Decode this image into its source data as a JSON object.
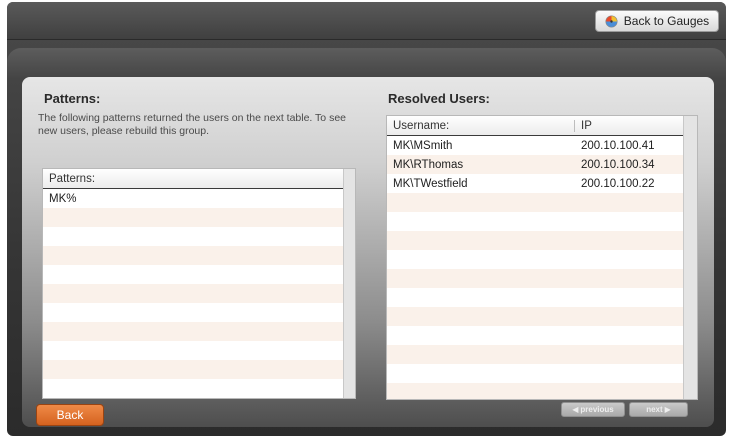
{
  "topbar": {
    "back_to_gauges_label": "Back to Gauges"
  },
  "patterns_section": {
    "title": "Patterns:",
    "description": "The following patterns returned the users on the next table. To see new users, please rebuild this group.",
    "table": {
      "header": "Patterns:",
      "rows": [
        "MK%",
        "",
        "",
        "",
        "",
        "",
        "",
        "",
        "",
        "",
        ""
      ]
    }
  },
  "users_section": {
    "title": "Resolved Users:",
    "table": {
      "columns": [
        "Username:",
        "IP"
      ],
      "rows": [
        [
          "MK\\MSmith",
          "200.10.100.41"
        ],
        [
          "MK\\RThomas",
          "200.10.100.34"
        ],
        [
          "MK\\TWestfield",
          "200.10.100.22"
        ],
        [
          "",
          ""
        ],
        [
          "",
          ""
        ],
        [
          "",
          ""
        ],
        [
          "",
          ""
        ],
        [
          "",
          ""
        ],
        [
          "",
          ""
        ],
        [
          "",
          ""
        ],
        [
          "",
          ""
        ],
        [
          "",
          ""
        ],
        [
          "",
          ""
        ],
        [
          "",
          ""
        ]
      ]
    }
  },
  "footer": {
    "back_label": "Back",
    "previous_label": "previous",
    "next_label": "next"
  },
  "colors": {
    "accent_orange": "#e0712e",
    "panel_light": "#e6e6e6",
    "frame_dark": "#3a3a3a"
  },
  "icons": {
    "gauge": "gauge-icon",
    "previous": "chevron-left-icon",
    "next": "chevron-right-icon"
  }
}
